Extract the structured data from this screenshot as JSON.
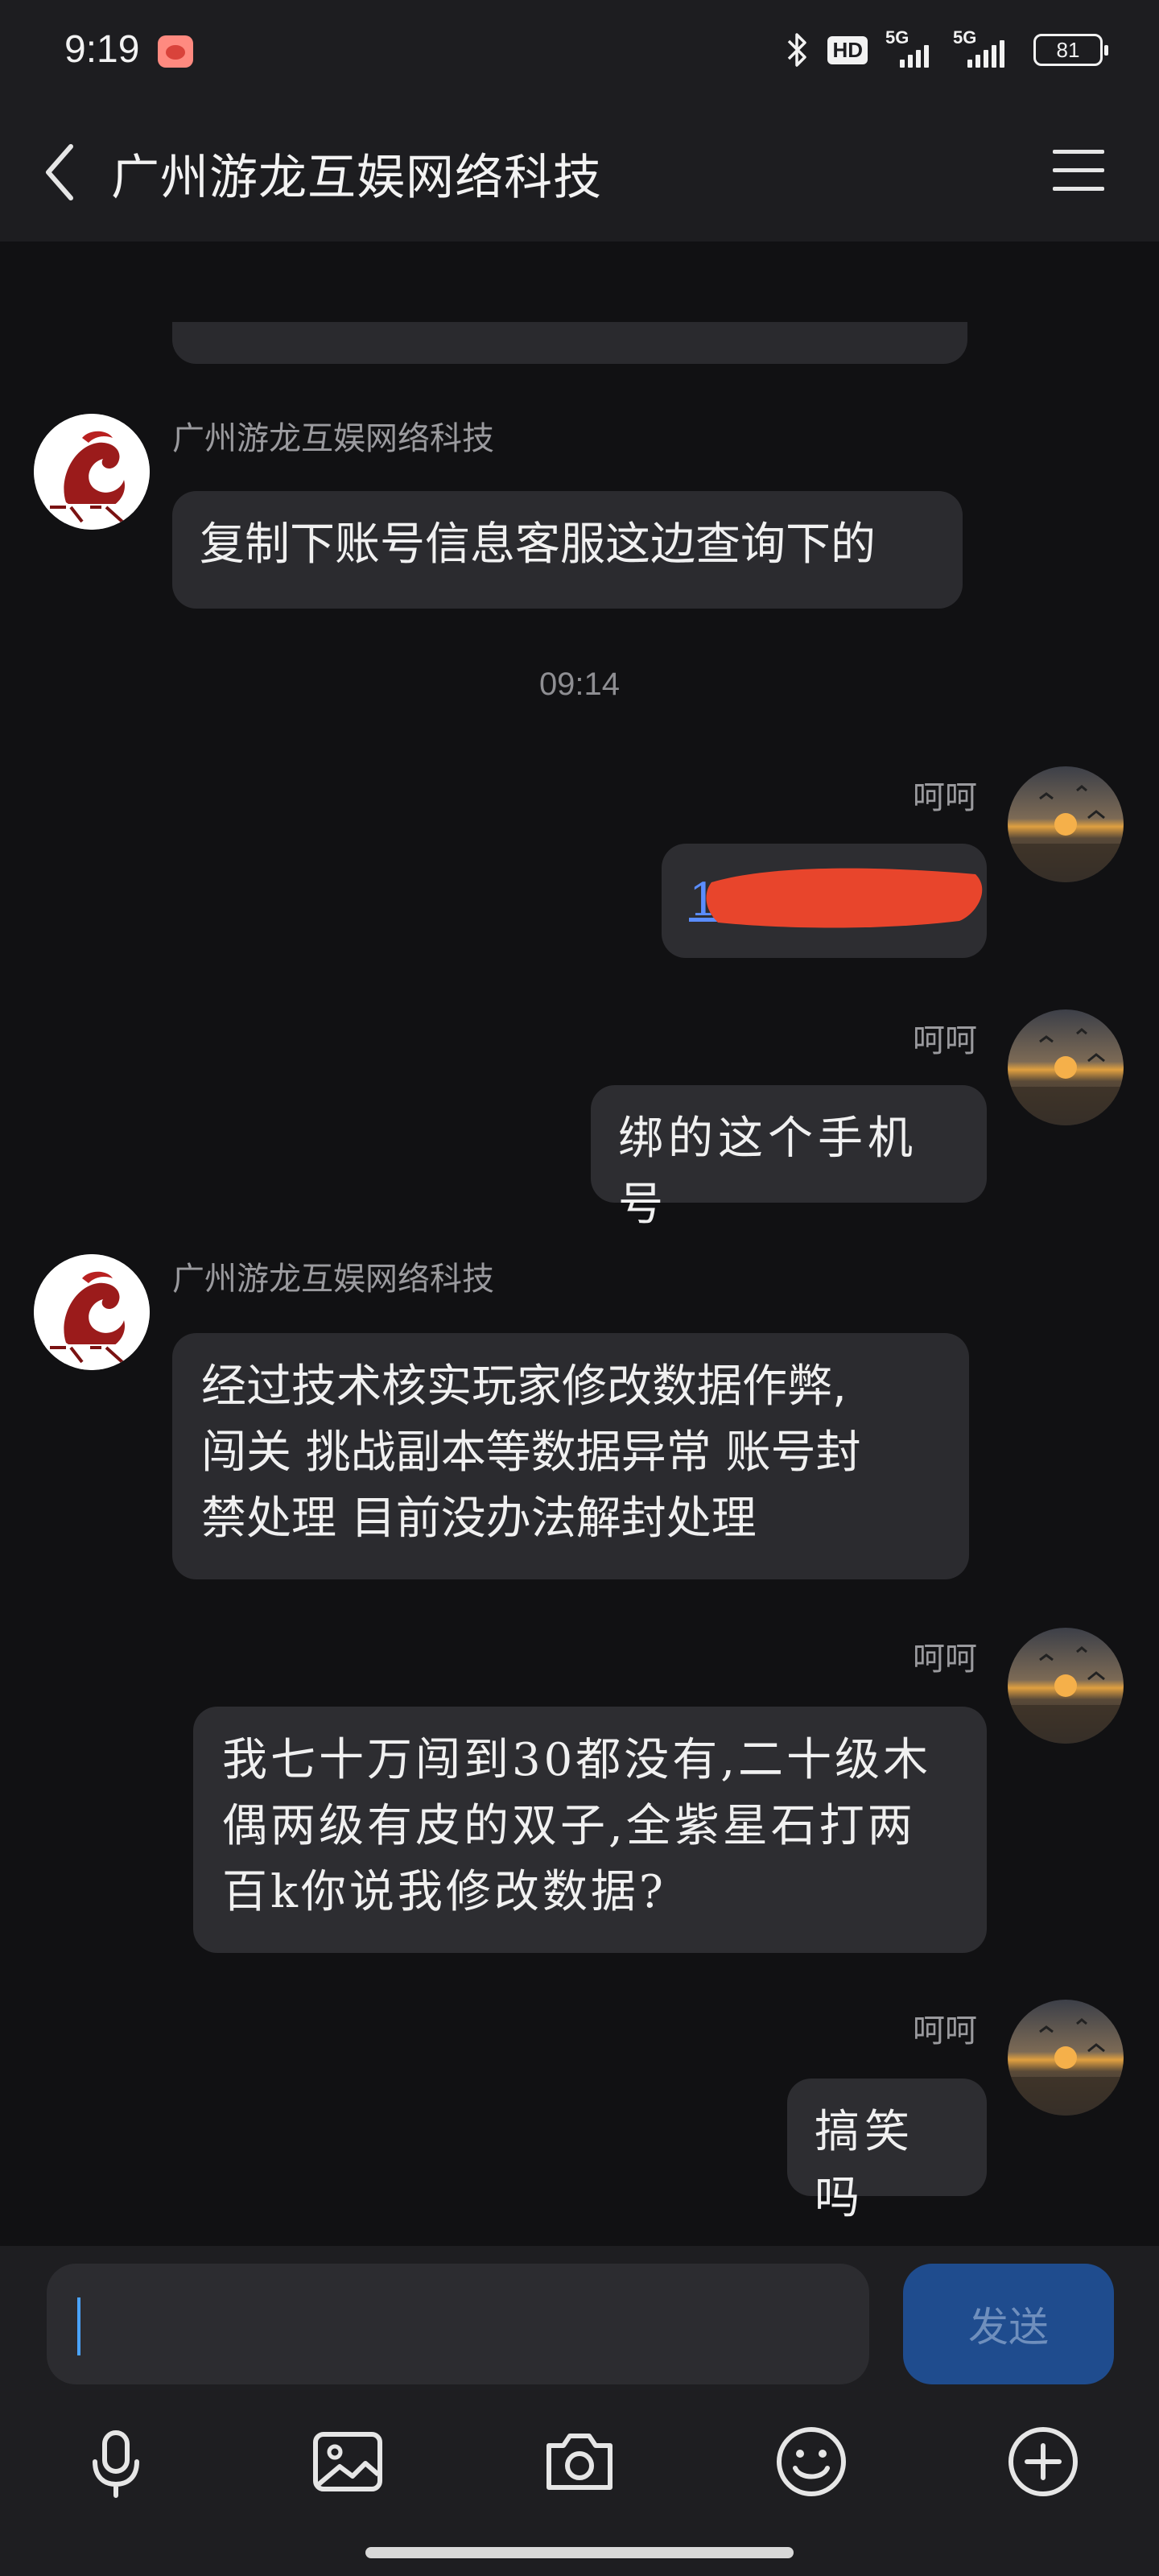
{
  "status_bar": {
    "time": "9:19",
    "hd_label": "HD",
    "signal1_label": "5G",
    "signal2_label": "5G",
    "battery": "81"
  },
  "header": {
    "title": "广州游龙互娱网络科技"
  },
  "messages": [
    {
      "sender": "广州游龙互娱网络科技",
      "text": "复制下账号信息客服这边查询下的"
    },
    {
      "timestamp": "09:14"
    },
    {
      "sender": "呵呵",
      "text": "1"
    },
    {
      "sender": "呵呵",
      "text": "绑的这个手机号"
    },
    {
      "sender": "广州游龙互娱网络科技",
      "lines": [
        "经过技术核实玩家修改数据作弊,",
        "闯关 挑战副本等数据异常 账号封",
        "禁处理 目前没办法解封处理"
      ]
    },
    {
      "sender": "呵呵",
      "lines": [
        "我七十万闯到30都没有,二十级木",
        "偶两级有皮的双子,全紫星石打两",
        "百k你说我修改数据?"
      ]
    },
    {
      "sender": "呵呵",
      "text": "搞笑吗"
    }
  ],
  "input": {
    "value": "",
    "send_label": "发送"
  },
  "colors": {
    "background": "#111113",
    "bar": "#1d1d20",
    "bubble": "#2b2b2f",
    "send": "#1f4c8e",
    "redaction": "#e8452c"
  },
  "icons": [
    "back-icon",
    "menu-icon",
    "mic-icon",
    "image-icon",
    "camera-icon",
    "emoji-icon",
    "plus-icon"
  ]
}
